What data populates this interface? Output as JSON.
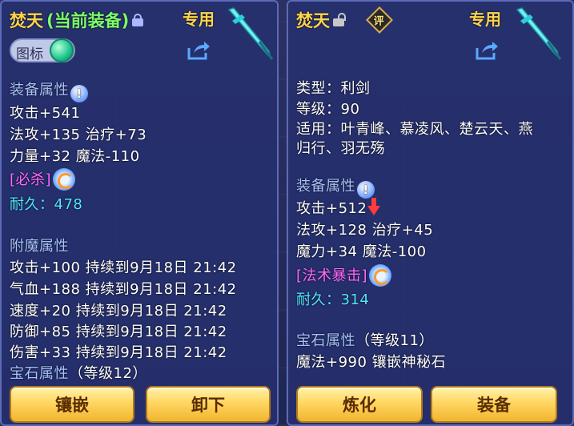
{
  "left": {
    "title": "焚天",
    "status": "(当前装备)",
    "exclusive": "专用",
    "toggle_label": "图标",
    "equip_attr_label": "装备属性",
    "stats": [
      "攻击+541",
      "法攻+135 治疗+73",
      "力量+32 魔法-110"
    ],
    "special": "[必杀]",
    "durability": "耐久：478",
    "enchant_label": "附魔属性",
    "enchants": [
      "攻击+100 持续到9月18日 21:42",
      "气血+188 持续到9月18日 21:42",
      "速度+20 持续到9月18日 21:42",
      "防御+85 持续到9月18日 21:42",
      "伤害+33 持续到9月18日 21:42"
    ],
    "gem_label": "宝石属性",
    "gem_level": "（等级12）",
    "buttons": [
      "镶嵌",
      "卸下"
    ]
  },
  "right": {
    "title": "焚天",
    "rate_icon": "评",
    "exclusive": "专用",
    "type": "类型：利剑",
    "level": "等级：90",
    "applicable_1": "适用：叶青峰、慕凌风、楚云天、燕",
    "applicable_2": "归行、羽无殇",
    "equip_attr_label": "装备属性",
    "stat_attack": "攻击+512",
    "stats": [
      "法攻+128 治疗+45",
      "魔力+34 魔法-100"
    ],
    "special": "[法术暴击]",
    "durability": "耐久：314",
    "gem_label": "宝石属性",
    "gem_level": "（等级11）",
    "gem_stat": "魔法+990 镶嵌神秘石",
    "buttons": [
      "炼化",
      "装备"
    ]
  },
  "colors": {
    "title": "#ffd54a",
    "section": "#a6c3ff",
    "special": "#ff6aff",
    "durability": "#52e8ff",
    "button": "#ffd35c"
  }
}
